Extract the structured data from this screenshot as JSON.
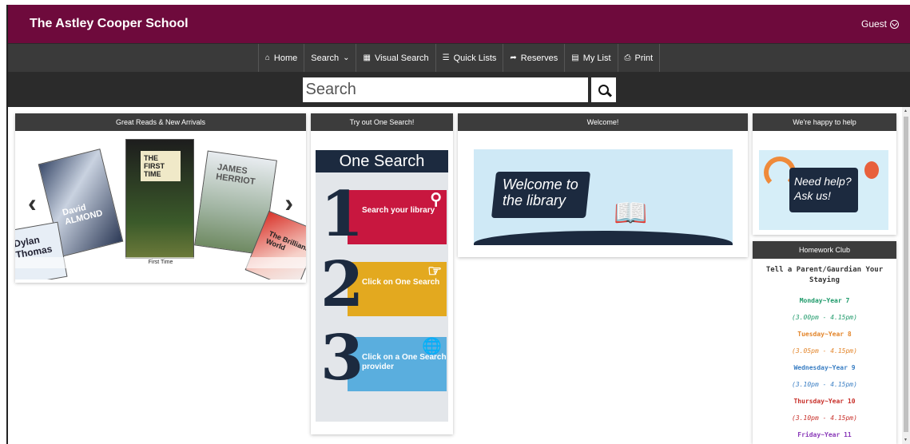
{
  "header": {
    "school_name": "The Astley Cooper School",
    "user": "Guest"
  },
  "nav": {
    "items": [
      {
        "label": "Home",
        "icon": "home-icon"
      },
      {
        "label": "Search",
        "icon": "chevron-down-icon"
      },
      {
        "label": "Visual Search",
        "icon": "grid-icon"
      },
      {
        "label": "Quick Lists",
        "icon": "list-icon"
      },
      {
        "label": "Reserves",
        "icon": "share-arrow-icon"
      },
      {
        "label": "My List",
        "icon": "list-card-icon"
      },
      {
        "label": "Print",
        "icon": "print-icon"
      }
    ]
  },
  "search": {
    "placeholder": "Search"
  },
  "panels": {
    "great_reads": {
      "title": "Great Reads & New Arrivals",
      "caption": "First Time",
      "books": [
        "THE FIRST TIME",
        "JAMES HERRIOT",
        "David ALMOND",
        "Dylan Thomas",
        "The Brilliant World"
      ]
    },
    "one_search": {
      "title": "Try out One Search!",
      "heading": "One Search",
      "steps": [
        {
          "num": "1",
          "text": "Search your library",
          "color": "#c8173f"
        },
        {
          "num": "2",
          "text": "Click on One Search",
          "color": "#e3a91f"
        },
        {
          "num": "3",
          "text": "Click on a One Search provider",
          "color": "#5aaede"
        }
      ]
    },
    "welcome": {
      "title": "Welcome!",
      "banner_text": "Welcome to the library"
    },
    "help": {
      "title": "We're happy to help",
      "banner_text": "Need help? Ask us!"
    },
    "homework": {
      "title": "Homework Club",
      "intro": "Tell a Parent/Gaurdian Your Staying",
      "lines": [
        {
          "text": "Monday~Year 7",
          "time": "(3.00pm - 4.15pm)",
          "color": "#1e9a6a"
        },
        {
          "text": "Tuesday~Year 8",
          "time": "(3.05pm - 4.15pm)",
          "color": "#e3852a"
        },
        {
          "text": "Wednesday~Year 9",
          "time": "(3.10pm - 4.15pm)",
          "color": "#3b7fc4"
        },
        {
          "text": "Thursday~Year 10",
          "time": "(3.10pm - 4.15pm)",
          "color": "#c8302a"
        },
        {
          "text": "Friday~Year 11",
          "time": "",
          "color": "#8a3ab9"
        }
      ]
    }
  },
  "colors": {
    "header": "#6e0a3c",
    "nav": "#3a3a3a",
    "panel_head": "#3c3c3c"
  }
}
